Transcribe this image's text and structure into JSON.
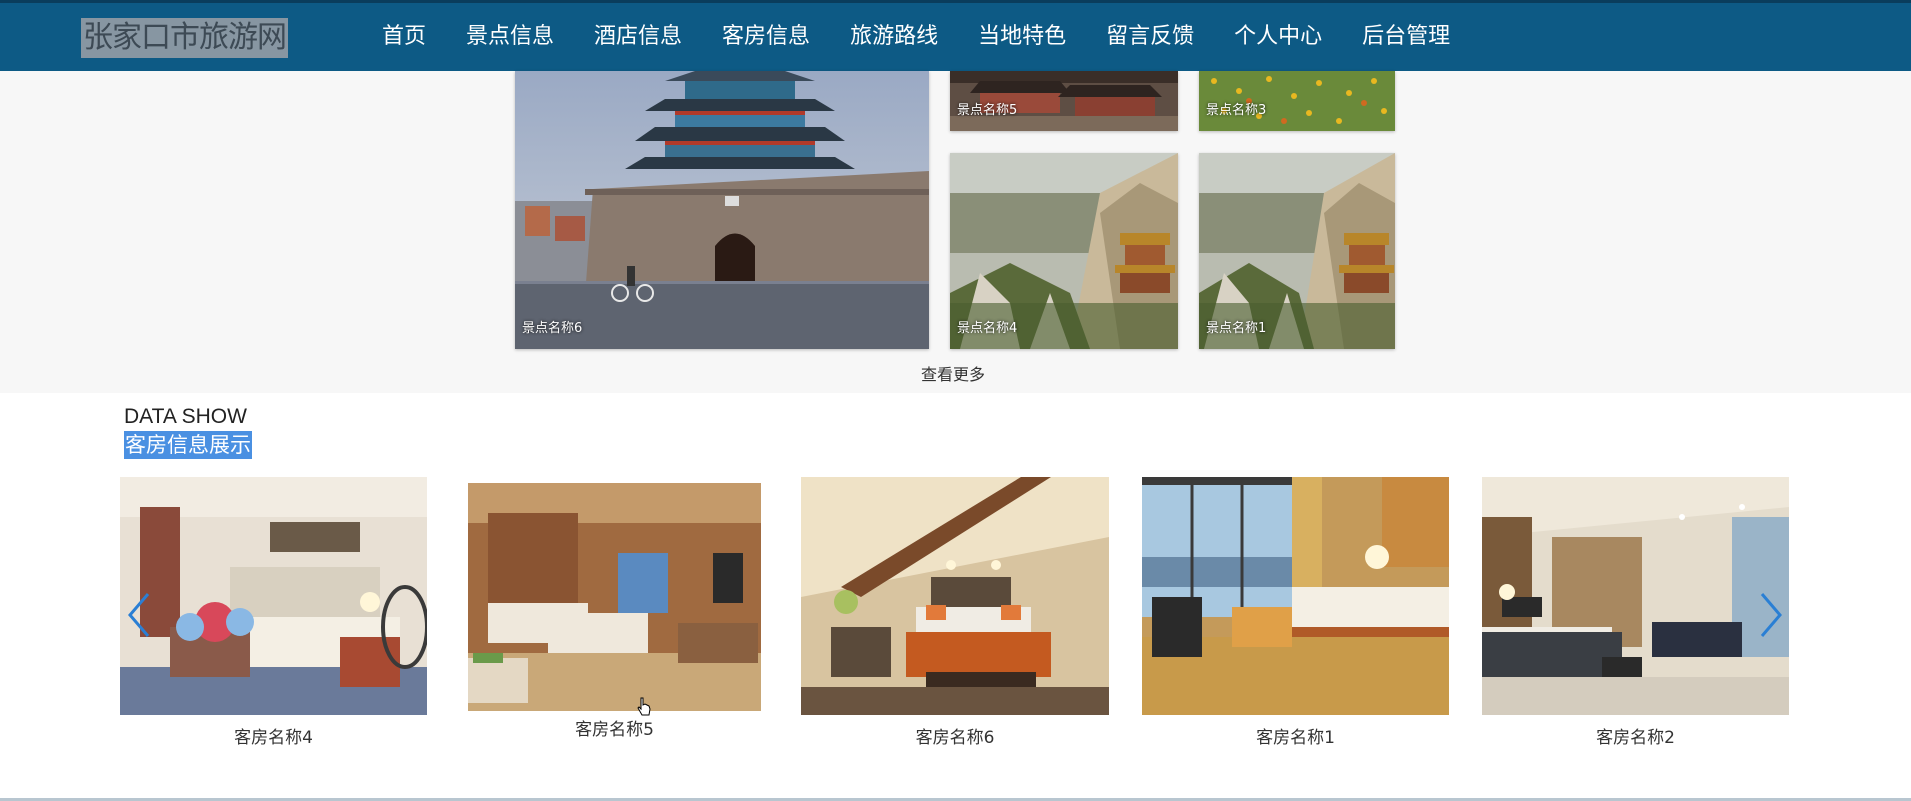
{
  "header": {
    "logo": "张家口市旅游网",
    "nav": [
      "首页",
      "景点信息",
      "酒店信息",
      "客房信息",
      "旅游路线",
      "当地特色",
      "留言反馈",
      "个人中心",
      "后台管理"
    ]
  },
  "spots": {
    "cards": [
      "景点名称6",
      "景点名称5",
      "景点名称3",
      "景点名称4",
      "景点名称1"
    ],
    "more": "查看更多"
  },
  "rooms": {
    "title_en": "DATA SHOW",
    "title_cn": "客房信息展示",
    "cards": [
      "客房名称4",
      "客房名称5",
      "客房名称6",
      "客房名称1",
      "客房名称2"
    ]
  },
  "colors": {
    "header": "#0d5a85",
    "highlight": "#4a90e2",
    "arrow": "#2a7fd4"
  }
}
